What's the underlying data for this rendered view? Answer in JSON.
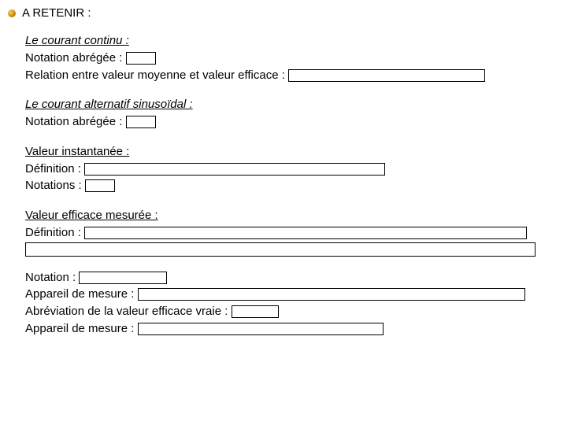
{
  "header": {
    "title": "A RETENIR :"
  },
  "cc": {
    "title": "Le courant continu :",
    "notation_label": "Notation abrégée :",
    "relation_label": "Relation entre valeur moyenne et valeur efficace :"
  },
  "ca": {
    "title": "Le courant alternatif sinusoïdal :",
    "notation_label": "Notation abrégée :"
  },
  "vi": {
    "title": "Valeur instantanée :",
    "def_label": "Définition :",
    "not_label": "Notations :"
  },
  "ve": {
    "title": "Valeur efficace mesurée :",
    "def_label": "Définition :"
  },
  "footer": {
    "notation_label": "Notation :",
    "appareil1_label": "Appareil de mesure :",
    "abrev_label": "Abréviation de la valeur efficace vraie :",
    "appareil2_label": "Appareil de mesure :"
  }
}
